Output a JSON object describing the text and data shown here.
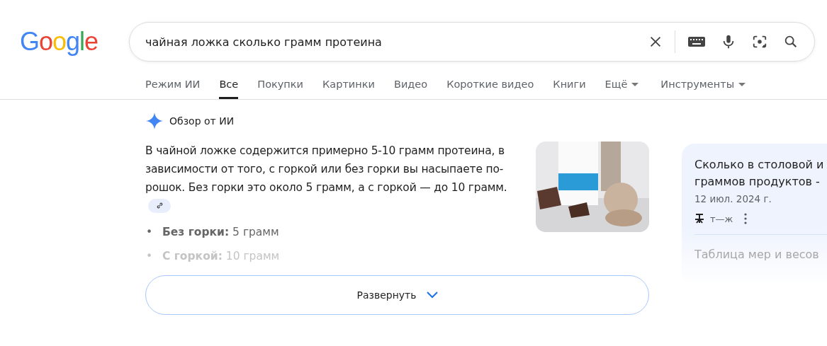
{
  "logo": "Google",
  "search": {
    "value": "чайная ложка сколько грамм протеина"
  },
  "tabs": [
    {
      "label": "Режим ИИ",
      "selected": false,
      "menu": false
    },
    {
      "label": "Все",
      "selected": true,
      "menu": false
    },
    {
      "label": "Покупки",
      "selected": false,
      "menu": false
    },
    {
      "label": "Картинки",
      "selected": false,
      "menu": false
    },
    {
      "label": "Видео",
      "selected": false,
      "menu": false
    },
    {
      "label": "Короткие видео",
      "selected": false,
      "menu": false
    },
    {
      "label": "Книги",
      "selected": false,
      "menu": false
    },
    {
      "label": "Ещё",
      "selected": false,
      "menu": true
    },
    {
      "label": "Инструменты",
      "selected": false,
      "menu": true
    }
  ],
  "overview": {
    "title": "Обзор от ИИ",
    "text_lines": [
      "В чайной ложке содержится примерно 5-10 грамм протеина, в",
      "зависимости от того, с горкой или без горки вы насыпаете по-",
      "рошок. Без горки это около 5 грамм, а с горкой — до 10 грамм."
    ],
    "bullets": [
      {
        "marker": "•",
        "label": "Без горки:",
        "value": "5 грамм"
      },
      {
        "marker": "•",
        "label": "С горкой:",
        "value": "10 грамм"
      }
    ],
    "expand_button": "Развернуть"
  },
  "source_card": {
    "title": "Сколько в столовой и граммов продуктов -",
    "date": "12 июл. 2024 г.",
    "site": "т—ж",
    "snippet": "Таблица мер и весов"
  }
}
